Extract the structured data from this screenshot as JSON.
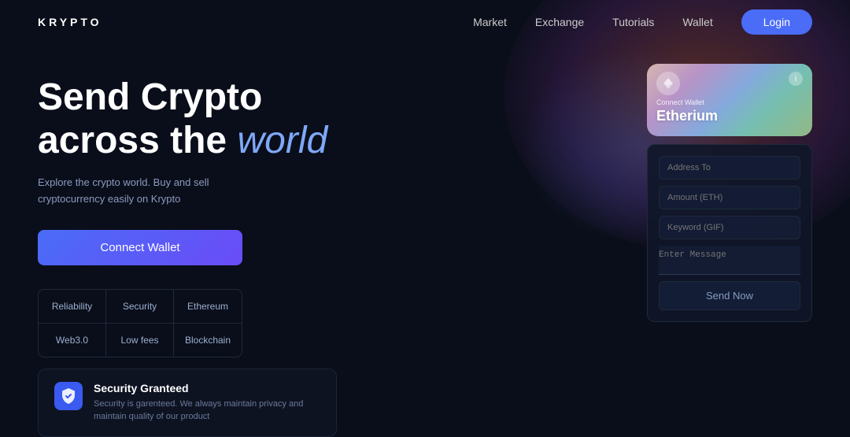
{
  "navbar": {
    "logo": "KRYPTO",
    "links": [
      {
        "label": "Market",
        "id": "market"
      },
      {
        "label": "Exchange",
        "id": "exchange"
      },
      {
        "label": "Tutorials",
        "id": "tutorials"
      },
      {
        "label": "Wallet",
        "id": "wallet"
      }
    ],
    "login_label": "Login"
  },
  "hero": {
    "title_line1": "Send Crypto",
    "title_line2_plain": "across the",
    "title_line2_highlight": "world",
    "subtitle": "Explore the crypto world. Buy and sell cryptocurrency easily on Krypto",
    "connect_button": "Connect Wallet"
  },
  "features": [
    "Reliability",
    "Security",
    "Ethereum",
    "Web3.0",
    "Low fees",
    "Blockchain"
  ],
  "wallet_card": {
    "label": "Connect Wallet",
    "name": "Etherium",
    "icon": "♦",
    "info": "i"
  },
  "send_form": {
    "address_placeholder": "Address To",
    "amount_placeholder": "Amount (ETH)",
    "keyword_placeholder": "Keyword (GIF)",
    "message_placeholder": "Enter Message",
    "send_button": "Send Now"
  },
  "security": {
    "title": "Security Granteed",
    "description": "Security is garenteed. We always maintain privacy and maintain quality of our product",
    "icon": "🛡"
  }
}
